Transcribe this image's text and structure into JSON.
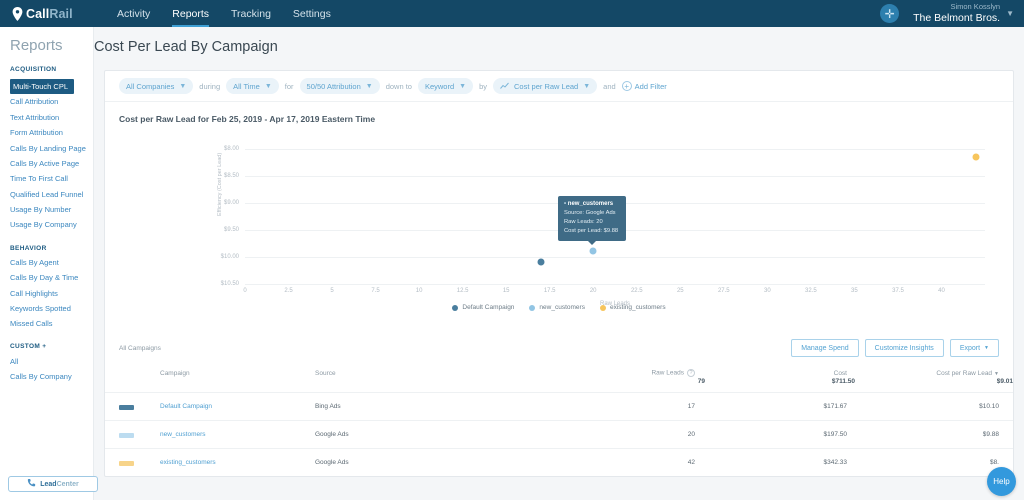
{
  "topnav": {
    "brand_bold": "Call",
    "brand_light": "Rail",
    "items": [
      {
        "label": "Activity",
        "active": false
      },
      {
        "label": "Reports",
        "active": true
      },
      {
        "label": "Tracking",
        "active": false
      },
      {
        "label": "Settings",
        "active": false
      }
    ],
    "add_icon": "plus-icon",
    "account_user": "Simon Kosslyn",
    "account_name": "The Belmont Bros.",
    "caret_icon": "chevron-down-icon"
  },
  "sidebar": {
    "title": "Reports",
    "groups": [
      {
        "label": "ACQUISITION",
        "items": [
          {
            "label": "Multi-Touch CPL",
            "active": true
          },
          {
            "label": "Call Attribution",
            "active": false
          },
          {
            "label": "Text Attribution",
            "active": false
          },
          {
            "label": "Form Attribution",
            "active": false
          },
          {
            "label": "Calls By Landing Page",
            "active": false
          },
          {
            "label": "Calls By Active Page",
            "active": false
          },
          {
            "label": "Time To First Call",
            "active": false
          },
          {
            "label": "Qualified Lead Funnel",
            "active": false
          },
          {
            "label": "Usage By Number",
            "active": false
          },
          {
            "label": "Usage By Company",
            "active": false
          }
        ]
      },
      {
        "label": "BEHAVIOR",
        "items": [
          {
            "label": "Calls By Agent",
            "active": false
          },
          {
            "label": "Calls By Day & Time",
            "active": false
          },
          {
            "label": "Call Highlights",
            "active": false
          },
          {
            "label": "Keywords Spotted",
            "active": false
          },
          {
            "label": "Missed Calls",
            "active": false
          }
        ]
      },
      {
        "label": "CUSTOM +",
        "items": [
          {
            "label": "All",
            "active": false
          },
          {
            "label": "Calls By Company",
            "active": false
          }
        ]
      }
    ]
  },
  "page": {
    "title": "Cost Per Lead By Campaign"
  },
  "filterbar": {
    "company": "All Companies",
    "during_label": "during",
    "time": "All Time",
    "for_label": "for",
    "attribution": "50/50 Attribution",
    "downto_label": "down to",
    "dimension": "Keyword",
    "by_label": "by",
    "metric": "Cost per Raw Lead",
    "and_label": "and",
    "add_filter": "Add Filter",
    "caret_icon": "chevron-down-icon",
    "metric_icon": "line-chart-icon",
    "add_icon": "plus-circle-icon"
  },
  "chart_header": "Cost per Raw Lead for Feb 25, 2019 - Apr 17, 2019 Eastern Time",
  "chart_data": {
    "type": "scatter",
    "title": "Cost per Raw Lead for Feb 25, 2019 - Apr 17, 2019 Eastern Time",
    "xlabel": "Raw Leads",
    "ylabel": "Efficiency (Cost per Lead)",
    "xlim": [
      0,
      42.5
    ],
    "ylim": [
      8.0,
      10.75
    ],
    "y_inverted": true,
    "grid": true,
    "legend_position": "bottom",
    "xticks": [
      0,
      2.5,
      5,
      7.5,
      10,
      12.5,
      15,
      17.5,
      20,
      22.5,
      25,
      27.5,
      30,
      32.5,
      35,
      37.5,
      40
    ],
    "xtick_labels": [
      "0",
      "2.5",
      "5",
      "7.5",
      "10",
      "12.5",
      "15",
      "17.5",
      "20",
      "22.5",
      "25",
      "27.5",
      "30",
      "32.5",
      "35",
      "37.5",
      "40"
    ],
    "yticks": [
      8.0,
      8.5,
      9.0,
      9.5,
      10.0,
      10.5
    ],
    "ytick_labels": [
      "$8.00",
      "$8.50",
      "$9.00",
      "$9.50",
      "$10.00",
      "$10.50"
    ],
    "series": [
      {
        "name": "Default Campaign",
        "color": "#4a7e9e",
        "x": [
          17
        ],
        "y": [
          10.1
        ]
      },
      {
        "name": "new_customers",
        "color": "#92c5e4",
        "x": [
          20
        ],
        "y": [
          9.88
        ]
      },
      {
        "name": "existing_customers",
        "color": "#f7c55c",
        "x": [
          42
        ],
        "y": [
          8.15
        ]
      }
    ]
  },
  "tooltip": {
    "bullet": "•",
    "title": "new_customers",
    "source": "Source: Google Ads",
    "raw_leads": "Raw Leads: 20",
    "cost_per_lead": "Cost per Lead: $9.88"
  },
  "legend": [
    {
      "label": "Default Campaign",
      "color": "#4a7e9e"
    },
    {
      "label": "new_customers",
      "color": "#92c5e4"
    },
    {
      "label": "existing_customers",
      "color": "#f7c55c"
    }
  ],
  "table_toolbar": {
    "all_campaigns": "All Campaigns",
    "manage_spend": "Manage Spend",
    "customize_insights": "Customize Insights",
    "export": "Export",
    "export_caret": "chevron-down-icon"
  },
  "table": {
    "headers": {
      "campaign": "Campaign",
      "source": "Source",
      "raw_leads": "Raw Leads",
      "raw_leads_help": "?",
      "cost": "Cost",
      "cost_per_raw_lead": "Cost per Raw Lead",
      "sort_caret": "▼"
    },
    "totals": {
      "campaign": "",
      "source": "",
      "raw_leads": "79",
      "cost": "$711.50",
      "cost_per_raw_lead": "$9.01"
    },
    "rows": [
      {
        "color": "#4a7e9e",
        "campaign": "Default Campaign",
        "source": "Bing Ads",
        "raw_leads": "17",
        "cost": "$171.67",
        "cost_per_raw_lead": "$10.10"
      },
      {
        "color": "#bcdcf0",
        "campaign": "new_customers",
        "source": "Google Ads",
        "raw_leads": "20",
        "cost": "$197.50",
        "cost_per_raw_lead": "$9.88"
      },
      {
        "color": "#f7d48a",
        "campaign": "existing_customers",
        "source": "Google Ads",
        "raw_leads": "42",
        "cost": "$342.33",
        "cost_per_raw_lead": "$8."
      }
    ]
  },
  "leadcenter": {
    "bold": "Lead",
    "light": "Center",
    "icon": "phone-icon"
  },
  "help": {
    "label": "Help"
  },
  "colors": {
    "nav_bg": "#144866",
    "accent": "#3399dd",
    "link": "#4f9fd1",
    "sidebar_active_bg": "#1d5b82"
  }
}
